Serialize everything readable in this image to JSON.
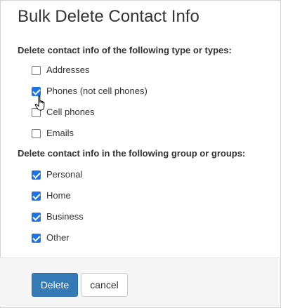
{
  "dialog": {
    "title": "Bulk Delete Contact Info"
  },
  "types_section": {
    "label": "Delete contact info of the following type or types:",
    "options": [
      {
        "label": "Addresses",
        "checked": false
      },
      {
        "label": "Phones (not cell phones)",
        "checked": true
      },
      {
        "label": "Cell phones",
        "checked": false
      },
      {
        "label": "Emails",
        "checked": false
      }
    ]
  },
  "groups_section": {
    "label": "Delete contact info in the following group or groups:",
    "options": [
      {
        "label": "Personal",
        "checked": true
      },
      {
        "label": "Home",
        "checked": true
      },
      {
        "label": "Business",
        "checked": true
      },
      {
        "label": "Other",
        "checked": true
      }
    ]
  },
  "footer": {
    "delete_label": "Delete",
    "cancel_label": "cancel"
  },
  "icons": {
    "cursor": "hand-pointer-icon"
  },
  "colors": {
    "checkbox_checked": "#1a73e8",
    "primary_button": "#337ab7"
  }
}
